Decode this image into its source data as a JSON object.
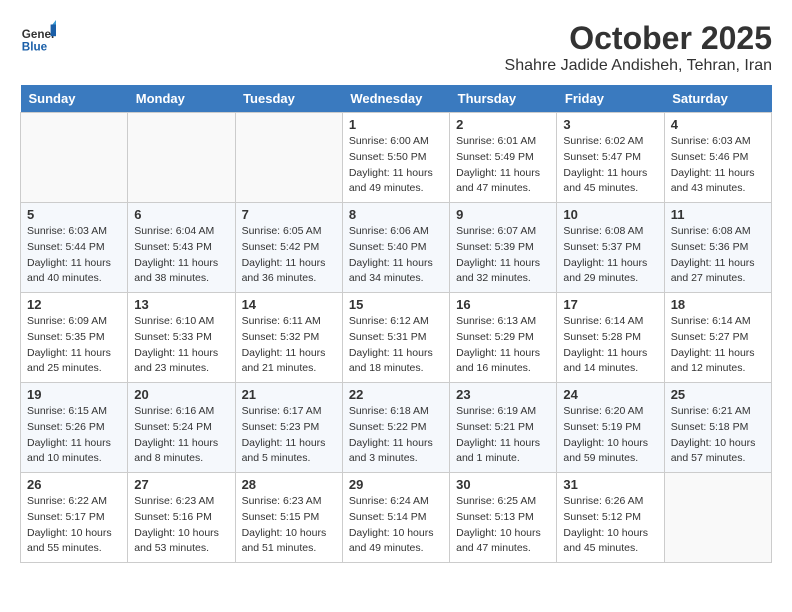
{
  "header": {
    "logo_line1": "General",
    "logo_line2": "Blue",
    "month": "October 2025",
    "location": "Shahre Jadide Andisheh, Tehran, Iran"
  },
  "weekdays": [
    "Sunday",
    "Monday",
    "Tuesday",
    "Wednesday",
    "Thursday",
    "Friday",
    "Saturday"
  ],
  "weeks": [
    [
      {
        "day": "",
        "info": ""
      },
      {
        "day": "",
        "info": ""
      },
      {
        "day": "",
        "info": ""
      },
      {
        "day": "1",
        "info": "Sunrise: 6:00 AM\nSunset: 5:50 PM\nDaylight: 11 hours\nand 49 minutes."
      },
      {
        "day": "2",
        "info": "Sunrise: 6:01 AM\nSunset: 5:49 PM\nDaylight: 11 hours\nand 47 minutes."
      },
      {
        "day": "3",
        "info": "Sunrise: 6:02 AM\nSunset: 5:47 PM\nDaylight: 11 hours\nand 45 minutes."
      },
      {
        "day": "4",
        "info": "Sunrise: 6:03 AM\nSunset: 5:46 PM\nDaylight: 11 hours\nand 43 minutes."
      }
    ],
    [
      {
        "day": "5",
        "info": "Sunrise: 6:03 AM\nSunset: 5:44 PM\nDaylight: 11 hours\nand 40 minutes."
      },
      {
        "day": "6",
        "info": "Sunrise: 6:04 AM\nSunset: 5:43 PM\nDaylight: 11 hours\nand 38 minutes."
      },
      {
        "day": "7",
        "info": "Sunrise: 6:05 AM\nSunset: 5:42 PM\nDaylight: 11 hours\nand 36 minutes."
      },
      {
        "day": "8",
        "info": "Sunrise: 6:06 AM\nSunset: 5:40 PM\nDaylight: 11 hours\nand 34 minutes."
      },
      {
        "day": "9",
        "info": "Sunrise: 6:07 AM\nSunset: 5:39 PM\nDaylight: 11 hours\nand 32 minutes."
      },
      {
        "day": "10",
        "info": "Sunrise: 6:08 AM\nSunset: 5:37 PM\nDaylight: 11 hours\nand 29 minutes."
      },
      {
        "day": "11",
        "info": "Sunrise: 6:08 AM\nSunset: 5:36 PM\nDaylight: 11 hours\nand 27 minutes."
      }
    ],
    [
      {
        "day": "12",
        "info": "Sunrise: 6:09 AM\nSunset: 5:35 PM\nDaylight: 11 hours\nand 25 minutes."
      },
      {
        "day": "13",
        "info": "Sunrise: 6:10 AM\nSunset: 5:33 PM\nDaylight: 11 hours\nand 23 minutes."
      },
      {
        "day": "14",
        "info": "Sunrise: 6:11 AM\nSunset: 5:32 PM\nDaylight: 11 hours\nand 21 minutes."
      },
      {
        "day": "15",
        "info": "Sunrise: 6:12 AM\nSunset: 5:31 PM\nDaylight: 11 hours\nand 18 minutes."
      },
      {
        "day": "16",
        "info": "Sunrise: 6:13 AM\nSunset: 5:29 PM\nDaylight: 11 hours\nand 16 minutes."
      },
      {
        "day": "17",
        "info": "Sunrise: 6:14 AM\nSunset: 5:28 PM\nDaylight: 11 hours\nand 14 minutes."
      },
      {
        "day": "18",
        "info": "Sunrise: 6:14 AM\nSunset: 5:27 PM\nDaylight: 11 hours\nand 12 minutes."
      }
    ],
    [
      {
        "day": "19",
        "info": "Sunrise: 6:15 AM\nSunset: 5:26 PM\nDaylight: 11 hours\nand 10 minutes."
      },
      {
        "day": "20",
        "info": "Sunrise: 6:16 AM\nSunset: 5:24 PM\nDaylight: 11 hours\nand 8 minutes."
      },
      {
        "day": "21",
        "info": "Sunrise: 6:17 AM\nSunset: 5:23 PM\nDaylight: 11 hours\nand 5 minutes."
      },
      {
        "day": "22",
        "info": "Sunrise: 6:18 AM\nSunset: 5:22 PM\nDaylight: 11 hours\nand 3 minutes."
      },
      {
        "day": "23",
        "info": "Sunrise: 6:19 AM\nSunset: 5:21 PM\nDaylight: 11 hours\nand 1 minute."
      },
      {
        "day": "24",
        "info": "Sunrise: 6:20 AM\nSunset: 5:19 PM\nDaylight: 10 hours\nand 59 minutes."
      },
      {
        "day": "25",
        "info": "Sunrise: 6:21 AM\nSunset: 5:18 PM\nDaylight: 10 hours\nand 57 minutes."
      }
    ],
    [
      {
        "day": "26",
        "info": "Sunrise: 6:22 AM\nSunset: 5:17 PM\nDaylight: 10 hours\nand 55 minutes."
      },
      {
        "day": "27",
        "info": "Sunrise: 6:23 AM\nSunset: 5:16 PM\nDaylight: 10 hours\nand 53 minutes."
      },
      {
        "day": "28",
        "info": "Sunrise: 6:23 AM\nSunset: 5:15 PM\nDaylight: 10 hours\nand 51 minutes."
      },
      {
        "day": "29",
        "info": "Sunrise: 6:24 AM\nSunset: 5:14 PM\nDaylight: 10 hours\nand 49 minutes."
      },
      {
        "day": "30",
        "info": "Sunrise: 6:25 AM\nSunset: 5:13 PM\nDaylight: 10 hours\nand 47 minutes."
      },
      {
        "day": "31",
        "info": "Sunrise: 6:26 AM\nSunset: 5:12 PM\nDaylight: 10 hours\nand 45 minutes."
      },
      {
        "day": "",
        "info": ""
      }
    ]
  ]
}
